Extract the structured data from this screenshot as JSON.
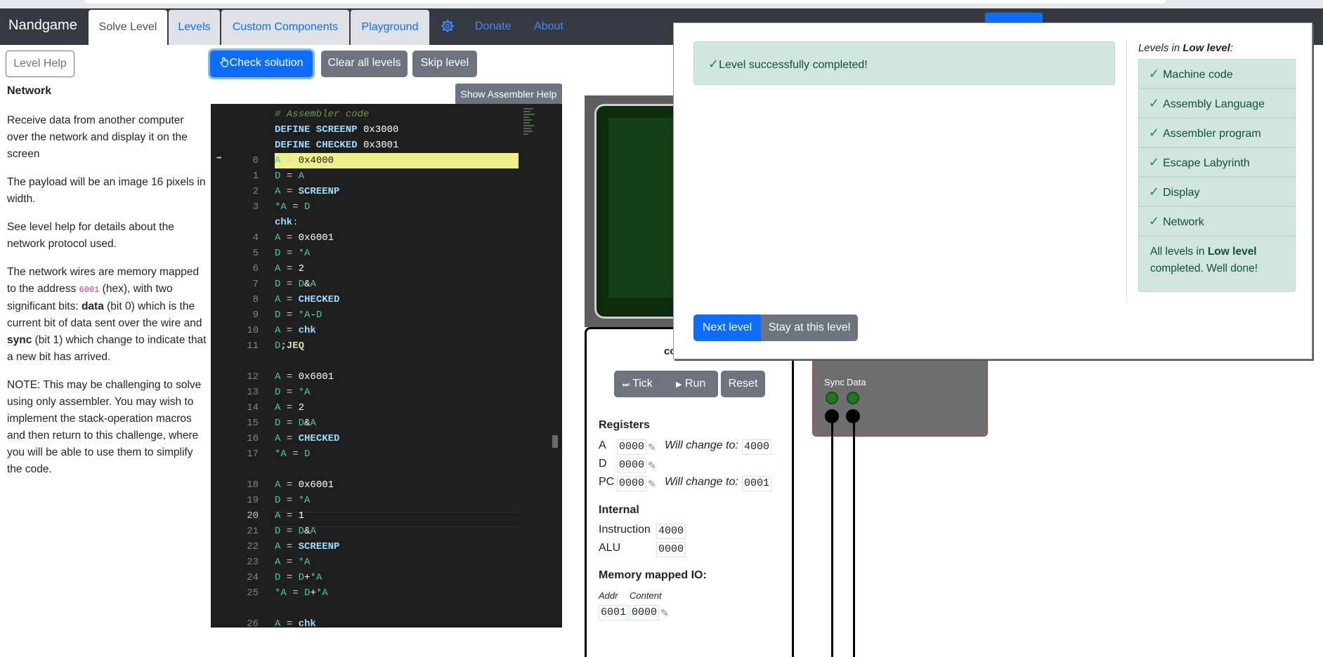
{
  "nav": {
    "brand": "Nandgame",
    "tabs": [
      "Solve Level",
      "Levels",
      "Custom Components",
      "Playground"
    ],
    "links": [
      "Donate",
      "About"
    ]
  },
  "toolbar": {
    "level_help": "Level Help",
    "check": "Check solution",
    "clear": "Clear all levels",
    "skip": "Skip level",
    "asm_help": "Show Assembler Help"
  },
  "level": {
    "title": "Network",
    "p1": "Receive data from another computer over the network and display it on the screen",
    "p2": "The payload will be an image 16 pixels in width.",
    "p3": "See level help for details about the network protocol used.",
    "p4a": "The network wires are memory mapped to the address ",
    "p4addr": "6001",
    "p4b": " (hex), with two significant bits: ",
    "p4data": "data",
    "p4c": " (bit 0) which is the current bit of data sent over the wire and ",
    "p4sync": "sync",
    "p4d": " (bit 1) which change to indicate that a new bit has arrived.",
    "p5": "NOTE: This may be challenging to solve using only assembler. You may wish to implement the stack-operation macros and then return to this challenge, where you will be able to use them to simplify the code."
  },
  "code_lines": [
    {
      "n": "",
      "tokens": [
        [
          "cmt",
          "# Assembler code"
        ]
      ]
    },
    {
      "n": "",
      "tokens": [
        [
          "kw",
          "DEFINE SCREENP "
        ],
        [
          "num",
          "0x3000"
        ]
      ]
    },
    {
      "n": "",
      "tokens": [
        [
          "kw",
          "DEFINE CHECKED "
        ],
        [
          "num",
          "0x3001"
        ]
      ]
    },
    {
      "n": "0",
      "hl": true,
      "tokens": [
        [
          "reg",
          "A"
        ],
        [
          "op",
          " = "
        ],
        [
          "num",
          "0x4000"
        ]
      ]
    },
    {
      "n": "1",
      "tokens": [
        [
          "reg",
          "D"
        ],
        [
          "op",
          " = "
        ],
        [
          "reg",
          "A"
        ]
      ]
    },
    {
      "n": "2",
      "tokens": [
        [
          "reg",
          "A"
        ],
        [
          "op",
          " = "
        ],
        [
          "kw",
          "SCREENP"
        ]
      ]
    },
    {
      "n": "3",
      "tokens": [
        [
          "reg",
          "*A"
        ],
        [
          "op",
          " = "
        ],
        [
          "reg",
          "D"
        ]
      ]
    },
    {
      "n": "",
      "tokens": [
        [
          "lbl",
          "chk"
        ],
        [
          "op",
          ":"
        ]
      ]
    },
    {
      "n": "4",
      "tokens": [
        [
          "reg",
          "A"
        ],
        [
          "op",
          " = "
        ],
        [
          "num",
          "0x6001"
        ]
      ]
    },
    {
      "n": "5",
      "tokens": [
        [
          "reg",
          "D"
        ],
        [
          "op",
          " = "
        ],
        [
          "reg",
          "*A"
        ]
      ]
    },
    {
      "n": "6",
      "tokens": [
        [
          "reg",
          "A"
        ],
        [
          "op",
          " = "
        ],
        [
          "num",
          "2"
        ]
      ]
    },
    {
      "n": "7",
      "tokens": [
        [
          "reg",
          "D"
        ],
        [
          "op",
          " = "
        ],
        [
          "reg",
          "D"
        ],
        [
          "num",
          "&"
        ],
        [
          "reg",
          "A"
        ]
      ]
    },
    {
      "n": "8",
      "tokens": [
        [
          "reg",
          "A"
        ],
        [
          "op",
          " = "
        ],
        [
          "kw",
          "CHECKED"
        ]
      ]
    },
    {
      "n": "9",
      "tokens": [
        [
          "reg",
          "D"
        ],
        [
          "op",
          " = "
        ],
        [
          "reg",
          "*A"
        ],
        [
          "op",
          "-"
        ],
        [
          "reg",
          "D"
        ]
      ]
    },
    {
      "n": "10",
      "tokens": [
        [
          "reg",
          "A"
        ],
        [
          "op",
          " = "
        ],
        [
          "lbl",
          "chk"
        ]
      ]
    },
    {
      "n": "11",
      "tokens": [
        [
          "reg",
          "D"
        ],
        [
          "jmp",
          ";JEQ"
        ]
      ]
    },
    {
      "n": "",
      "tokens": []
    },
    {
      "n": "12",
      "tokens": [
        [
          "reg",
          "A"
        ],
        [
          "op",
          " = "
        ],
        [
          "num",
          "0x6001"
        ]
      ]
    },
    {
      "n": "13",
      "tokens": [
        [
          "reg",
          "D"
        ],
        [
          "op",
          " = "
        ],
        [
          "reg",
          "*A"
        ]
      ]
    },
    {
      "n": "14",
      "tokens": [
        [
          "reg",
          "A"
        ],
        [
          "op",
          " = "
        ],
        [
          "num",
          "2"
        ]
      ]
    },
    {
      "n": "15",
      "tokens": [
        [
          "reg",
          "D"
        ],
        [
          "op",
          " = "
        ],
        [
          "reg",
          "D"
        ],
        [
          "num",
          "&"
        ],
        [
          "reg",
          "A"
        ]
      ]
    },
    {
      "n": "16",
      "tokens": [
        [
          "reg",
          "A"
        ],
        [
          "op",
          " = "
        ],
        [
          "kw",
          "CHECKED"
        ]
      ]
    },
    {
      "n": "17",
      "tokens": [
        [
          "reg",
          "*A"
        ],
        [
          "op",
          " = "
        ],
        [
          "reg",
          "D"
        ]
      ]
    },
    {
      "n": "",
      "tokens": []
    },
    {
      "n": "18",
      "tokens": [
        [
          "reg",
          "A"
        ],
        [
          "op",
          " = "
        ],
        [
          "num",
          "0x6001"
        ]
      ]
    },
    {
      "n": "19",
      "tokens": [
        [
          "reg",
          "D"
        ],
        [
          "op",
          " = "
        ],
        [
          "reg",
          "*A"
        ]
      ]
    },
    {
      "n": "20",
      "cur": true,
      "tokens": [
        [
          "reg",
          "A"
        ],
        [
          "op",
          " = "
        ],
        [
          "num",
          "1"
        ]
      ]
    },
    {
      "n": "21",
      "tokens": [
        [
          "reg",
          "D"
        ],
        [
          "op",
          " = "
        ],
        [
          "reg",
          "D"
        ],
        [
          "num",
          "&"
        ],
        [
          "reg",
          "A"
        ]
      ]
    },
    {
      "n": "22",
      "tokens": [
        [
          "reg",
          "A"
        ],
        [
          "op",
          " = "
        ],
        [
          "kw",
          "SCREENP"
        ]
      ]
    },
    {
      "n": "23",
      "tokens": [
        [
          "reg",
          "A"
        ],
        [
          "op",
          " = "
        ],
        [
          "reg",
          "*A"
        ]
      ]
    },
    {
      "n": "24",
      "tokens": [
        [
          "reg",
          "D"
        ],
        [
          "op",
          " = "
        ],
        [
          "reg",
          "D"
        ],
        [
          "num",
          "+"
        ],
        [
          "reg",
          "*A"
        ]
      ]
    },
    {
      "n": "25",
      "tokens": [
        [
          "reg",
          "*A"
        ],
        [
          "op",
          " = "
        ],
        [
          "reg",
          "D"
        ],
        [
          "num",
          "+"
        ],
        [
          "reg",
          "*A"
        ]
      ]
    },
    {
      "n": "",
      "tokens": []
    },
    {
      "n": "26",
      "tokens": [
        [
          "reg",
          "A"
        ],
        [
          "op",
          " = "
        ],
        [
          "lbl",
          "chk"
        ]
      ]
    }
  ],
  "computer": {
    "title": "co",
    "tick": "Tick",
    "run": "Run",
    "reset": "Reset",
    "registers_title": "Registers",
    "reg_a_label": "A",
    "reg_a": "0000",
    "reg_a_next": "4000",
    "reg_d_label": "D",
    "reg_d": "0000",
    "reg_pc_label": "PC",
    "reg_pc": "0000",
    "reg_pc_next": "0001",
    "will_change": "Will change to:",
    "internal_title": "Internal",
    "instruction_label": "Instruction",
    "instruction": "4000",
    "alu_label": "ALU",
    "alu": "0000",
    "mmio_title": "Memory mapped IO:",
    "mmio_addr_head": "Addr",
    "mmio_content_head": "Content",
    "mmio_addr": "6001",
    "mmio_content": "0000"
  },
  "device": {
    "sync_label": "Sync",
    "data_label": "Data"
  },
  "popup": {
    "success": "Level successfully completed!",
    "levels_heading_pre": "Levels in ",
    "levels_heading_bold": "Low level",
    "levels_heading_post": ":",
    "levels": [
      "Machine code",
      "Assembly Language",
      "Assembler program",
      "Escape Labyrinth",
      "Display",
      "Network"
    ],
    "all_done_pre": "All levels in ",
    "all_done_bold": "Low level",
    "all_done_post": " completed. Well done!",
    "next": "Next level",
    "stay": "Stay at this level"
  }
}
